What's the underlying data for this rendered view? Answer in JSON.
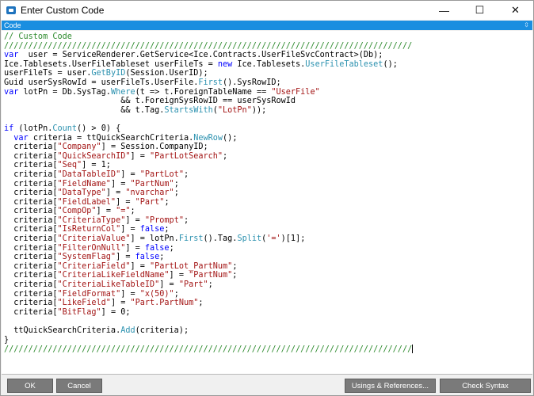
{
  "window": {
    "title": "Enter Custom Code",
    "minimize_glyph": "—",
    "maximize_glyph": "☐",
    "close_glyph": "✕"
  },
  "panel": {
    "title": "Code",
    "pin_glyph": "⇳"
  },
  "code_lines": [
    [
      [
        "c",
        "// Custom Code"
      ]
    ],
    [
      [
        "c",
        "////////////////////////////////////////////////////////////////////////////////////"
      ]
    ],
    [
      [
        "k",
        "var"
      ],
      [
        "",
        "  user = ServiceRenderer.GetService<Ice.Contracts.UserFileSvcContract>(Db);"
      ]
    ],
    [
      [
        "",
        "Ice.Tablesets.UserFileTableset userFileTs = "
      ],
      [
        "k",
        "new"
      ],
      [
        "",
        " Ice.Tablesets."
      ],
      [
        "t",
        "UserFileTableset"
      ],
      [
        "",
        "();"
      ]
    ],
    [
      [
        "",
        "userFileTs = user."
      ],
      [
        "t",
        "GetByID"
      ],
      [
        "",
        "(Session.UserID);"
      ]
    ],
    [
      [
        "",
        "Guid userSysRowId = userFileTs.UserFile."
      ],
      [
        "t",
        "First"
      ],
      [
        "",
        "().SysRowID;"
      ]
    ],
    [
      [
        "k",
        "var"
      ],
      [
        "",
        " lotPn = Db.SysTag."
      ],
      [
        "t",
        "Where"
      ],
      [
        "",
        "(t => t.ForeignTableName == "
      ],
      [
        "s",
        "\"UserFile\""
      ]
    ],
    [
      [
        "",
        "                        && t.ForeignSysRowID == userSysRowId"
      ]
    ],
    [
      [
        "",
        "                        && t.Tag."
      ],
      [
        "t",
        "StartsWith"
      ],
      [
        "",
        "("
      ],
      [
        "s",
        "\"LotPn\""
      ],
      [
        "",
        "));"
      ]
    ],
    [
      [
        "",
        ""
      ]
    ],
    [
      [
        "k",
        "if"
      ],
      [
        "",
        " (lotPn."
      ],
      [
        "t",
        "Count"
      ],
      [
        "",
        "() > 0) {"
      ]
    ],
    [
      [
        "",
        "  "
      ],
      [
        "k",
        "var"
      ],
      [
        "",
        " criteria = ttQuickSearchCriteria."
      ],
      [
        "t",
        "NewRow"
      ],
      [
        "",
        "();"
      ]
    ],
    [
      [
        "",
        "  criteria["
      ],
      [
        "s",
        "\"Company\""
      ],
      [
        "",
        "] = Session.CompanyID;"
      ]
    ],
    [
      [
        "",
        "  criteria["
      ],
      [
        "s",
        "\"QuickSearchID\""
      ],
      [
        "",
        "] = "
      ],
      [
        "s",
        "\"PartLotSearch\""
      ],
      [
        "",
        ";"
      ]
    ],
    [
      [
        "",
        "  criteria["
      ],
      [
        "s",
        "\"Seq\""
      ],
      [
        "",
        "] = 1;"
      ]
    ],
    [
      [
        "",
        "  criteria["
      ],
      [
        "s",
        "\"DataTableID\""
      ],
      [
        "",
        "] = "
      ],
      [
        "s",
        "\"PartLot\""
      ],
      [
        "",
        ";"
      ]
    ],
    [
      [
        "",
        "  criteria["
      ],
      [
        "s",
        "\"FieldName\""
      ],
      [
        "",
        "] = "
      ],
      [
        "s",
        "\"PartNum\""
      ],
      [
        "",
        ";"
      ]
    ],
    [
      [
        "",
        "  criteria["
      ],
      [
        "s",
        "\"DataType\""
      ],
      [
        "",
        "] = "
      ],
      [
        "s",
        "\"nvarchar\""
      ],
      [
        "",
        ";"
      ]
    ],
    [
      [
        "",
        "  criteria["
      ],
      [
        "s",
        "\"FieldLabel\""
      ],
      [
        "",
        "] = "
      ],
      [
        "s",
        "\"Part\""
      ],
      [
        "",
        ";"
      ]
    ],
    [
      [
        "",
        "  criteria["
      ],
      [
        "s",
        "\"CompOp\""
      ],
      [
        "",
        "] = "
      ],
      [
        "s",
        "\"=\""
      ],
      [
        "",
        ";"
      ]
    ],
    [
      [
        "",
        "  criteria["
      ],
      [
        "s",
        "\"CriteriaType\""
      ],
      [
        "",
        "] = "
      ],
      [
        "s",
        "\"Prompt\""
      ],
      [
        "",
        ";"
      ]
    ],
    [
      [
        "",
        "  criteria["
      ],
      [
        "s",
        "\"IsReturnCol\""
      ],
      [
        "",
        "] = "
      ],
      [
        "k",
        "false"
      ],
      [
        "",
        ";"
      ]
    ],
    [
      [
        "",
        "  criteria["
      ],
      [
        "s",
        "\"CriteriaValue\""
      ],
      [
        "",
        "] = lotPn."
      ],
      [
        "t",
        "First"
      ],
      [
        "",
        "().Tag."
      ],
      [
        "t",
        "Split"
      ],
      [
        "",
        "("
      ],
      [
        "s",
        "'='"
      ],
      [
        "",
        ")[1];"
      ]
    ],
    [
      [
        "",
        "  criteria["
      ],
      [
        "s",
        "\"FilterOnNull\""
      ],
      [
        "",
        "] = "
      ],
      [
        "k",
        "false"
      ],
      [
        "",
        ";"
      ]
    ],
    [
      [
        "",
        "  criteria["
      ],
      [
        "s",
        "\"SystemFlag\""
      ],
      [
        "",
        "] = "
      ],
      [
        "k",
        "false"
      ],
      [
        "",
        ";"
      ]
    ],
    [
      [
        "",
        "  criteria["
      ],
      [
        "s",
        "\"CriteriaField\""
      ],
      [
        "",
        "] = "
      ],
      [
        "s",
        "\"PartLot_PartNum\""
      ],
      [
        "",
        ";"
      ]
    ],
    [
      [
        "",
        "  criteria["
      ],
      [
        "s",
        "\"CriteriaLikeFieldName\""
      ],
      [
        "",
        "] = "
      ],
      [
        "s",
        "\"PartNum\""
      ],
      [
        "",
        ";"
      ]
    ],
    [
      [
        "",
        "  criteria["
      ],
      [
        "s",
        "\"CriteriaLikeTableID\""
      ],
      [
        "",
        "] = "
      ],
      [
        "s",
        "\"Part\""
      ],
      [
        "",
        ";"
      ]
    ],
    [
      [
        "",
        "  criteria["
      ],
      [
        "s",
        "\"FieldFormat\""
      ],
      [
        "",
        "] = "
      ],
      [
        "s",
        "\"x(50)\""
      ],
      [
        "",
        ";"
      ]
    ],
    [
      [
        "",
        "  criteria["
      ],
      [
        "s",
        "\"LikeField\""
      ],
      [
        "",
        "] = "
      ],
      [
        "s",
        "\"Part.PartNum\""
      ],
      [
        "",
        ";"
      ]
    ],
    [
      [
        "",
        "  criteria["
      ],
      [
        "s",
        "\"BitFlag\""
      ],
      [
        "",
        "] = 0;"
      ]
    ],
    [
      [
        "",
        ""
      ]
    ],
    [
      [
        "",
        "  ttQuickSearchCriteria."
      ],
      [
        "t",
        "Add"
      ],
      [
        "",
        "(criteria);"
      ]
    ],
    [
      [
        "",
        "}"
      ]
    ],
    [
      [
        "c",
        "////////////////////////////////////////////////////////////////////////////////////"
      ]
    ]
  ],
  "buttons": {
    "ok": "OK",
    "cancel": "Cancel",
    "usings": "Usings & References...",
    "check_syntax": "Check Syntax"
  }
}
